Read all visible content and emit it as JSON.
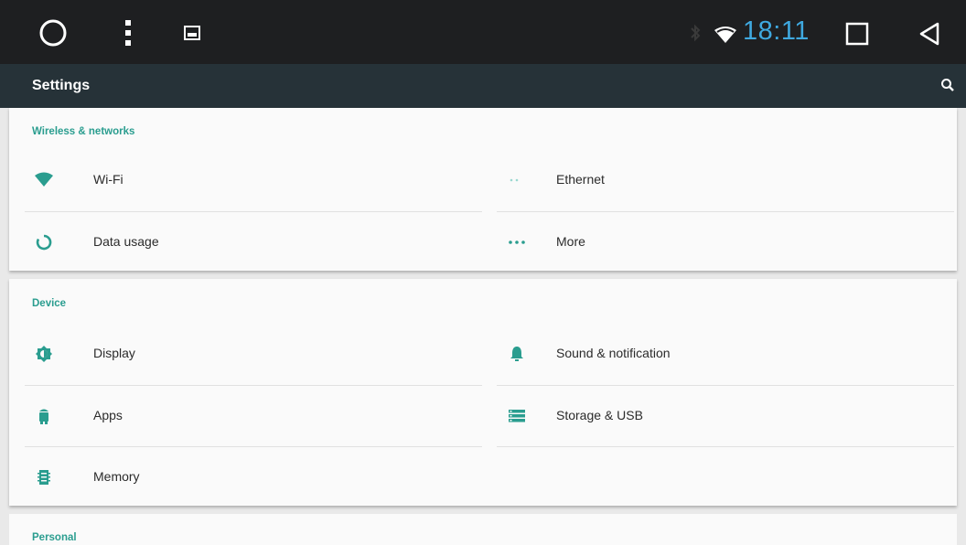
{
  "status_bar": {
    "time": "18:11",
    "icons": [
      "home-circle-icon",
      "menu-dots-icon",
      "gallery-icon",
      "bluetooth-icon",
      "wifi-icon",
      "recents-square-icon",
      "back-triangle-icon"
    ],
    "accent_color": "#3fa9e0"
  },
  "app_bar": {
    "title": "Settings",
    "search_icon": "search-icon",
    "background": "#263238"
  },
  "sections": [
    {
      "title": "Wireless & networks",
      "items": [
        {
          "label": "Wi-Fi",
          "icon": "wifi-icon"
        },
        {
          "label": "Ethernet",
          "icon": "ethernet-icon"
        },
        {
          "label": "Data usage",
          "icon": "data-usage-icon"
        },
        {
          "label": "More",
          "icon": "more-dots-icon"
        }
      ]
    },
    {
      "title": "Device",
      "items": [
        {
          "label": "Display",
          "icon": "brightness-icon"
        },
        {
          "label": "Sound & notification",
          "icon": "bell-icon"
        },
        {
          "label": "Apps",
          "icon": "android-icon"
        },
        {
          "label": "Storage & USB",
          "icon": "storage-icon"
        },
        {
          "label": "Memory",
          "icon": "memory-icon"
        }
      ]
    },
    {
      "title": "Personal",
      "items": []
    }
  ],
  "accent_color": "#2a9d8f"
}
